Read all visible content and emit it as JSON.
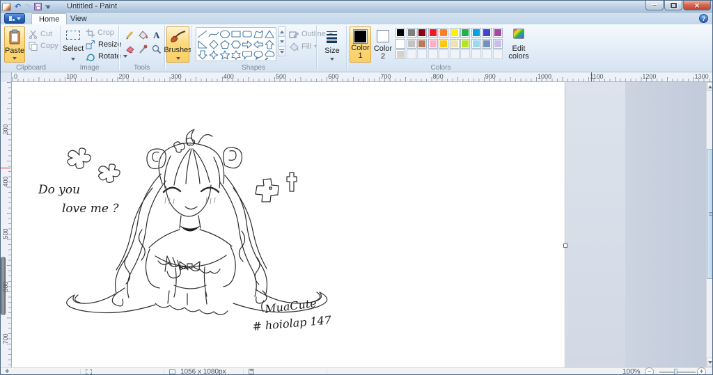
{
  "window": {
    "title": "Untitled - Paint"
  },
  "app_menu": {
    "tabs": [
      "Home",
      "View"
    ]
  },
  "ribbon": {
    "groups": {
      "clipboard": {
        "label": "Clipboard",
        "paste": "Paste",
        "cut": "Cut",
        "copy": "Copy"
      },
      "image": {
        "label": "Image",
        "select": "Select",
        "crop": "Crop",
        "resize": "Resize",
        "rotate": "Rotate"
      },
      "tools": {
        "label": "Tools",
        "tool_names": [
          "pencil",
          "fill-with-color",
          "text",
          "eraser",
          "color-picker",
          "magnifier"
        ]
      },
      "brushes": {
        "label": "Brushes"
      },
      "shapes": {
        "label": "Shapes",
        "outline": "Outline",
        "fill": "Fill",
        "shape_names": [
          "line",
          "curve",
          "oval",
          "rectangle",
          "rounded-rectangle",
          "polygon",
          "triangle",
          "right-triangle",
          "diamond",
          "pentagon",
          "hexagon",
          "right-arrow",
          "left-arrow",
          "up-arrow",
          "down-arrow",
          "four-point-star",
          "five-point-star",
          "six-point-star",
          "rounded-callout",
          "oval-callout",
          "cloud-callout"
        ]
      },
      "size": {
        "label": "Size"
      },
      "colors": {
        "label": "Colors",
        "color1_label": "Color 1",
        "color2_label": "Color 2",
        "edit_colors_label": "Edit colors",
        "color1_value": "#000000",
        "color2_value": "#ffffff",
        "palette_row1": [
          "#000000",
          "#7f7f7f",
          "#880015",
          "#ed1c24",
          "#ff7f27",
          "#fff200",
          "#22b14c",
          "#00a2e8",
          "#3f48cc",
          "#a349a4"
        ],
        "palette_row2": [
          "#ffffff",
          "#c3c3c3",
          "#b97a57",
          "#ffaec9",
          "#ffc90e",
          "#efe4b0",
          "#b5e61d",
          "#99d9ea",
          "#7092be",
          "#c8bfe7"
        ],
        "custom_color": "#d6d2c8",
        "empty_cells": 9
      }
    }
  },
  "rulers": {
    "horizontal_labels": [
      "0",
      "100",
      "200",
      "300",
      "400",
      "500",
      "600",
      "700",
      "800",
      "900",
      "1000",
      "1100",
      "1200",
      "1300"
    ],
    "vertical_labels": [
      "300",
      "400",
      "500",
      "600",
      "700"
    ]
  },
  "canvas": {
    "handwriting": {
      "line1": "Do you",
      "line2": "love me ?"
    },
    "signature": {
      "line1": "MuaCute",
      "line2": "# hoiolap 147"
    }
  },
  "status_bar": {
    "canvas_size": "1056 x 1080px",
    "zoom_level": "100%"
  },
  "theme": {
    "highlight": "#fbd97c",
    "titlebar": "#bcd0e6",
    "shape_stroke": "#4a7ba6"
  }
}
